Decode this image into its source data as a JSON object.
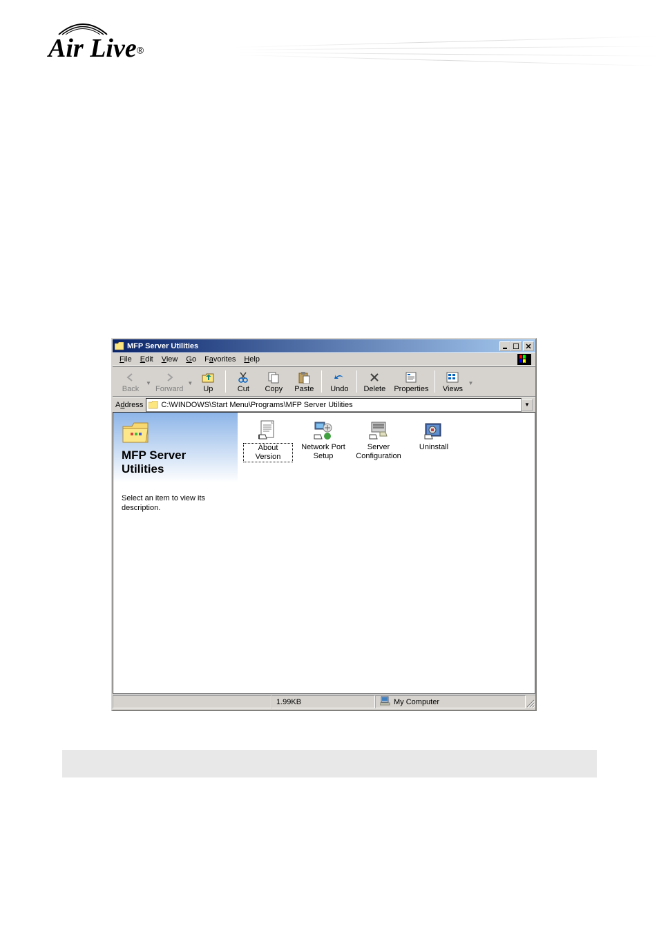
{
  "logo": {
    "brand": "Air Live",
    "registered": "®"
  },
  "window": {
    "title": "MFP Server Utilities"
  },
  "menubar": {
    "items": [
      {
        "label": "File",
        "accel": "F"
      },
      {
        "label": "Edit",
        "accel": "E"
      },
      {
        "label": "View",
        "accel": "V"
      },
      {
        "label": "Go",
        "accel": "G"
      },
      {
        "label": "Favorites",
        "accel": "a"
      },
      {
        "label": "Help",
        "accel": "H"
      }
    ]
  },
  "toolbar": {
    "back": "Back",
    "forward": "Forward",
    "up": "Up",
    "cut": "Cut",
    "copy": "Copy",
    "paste": "Paste",
    "undo": "Undo",
    "delete": "Delete",
    "properties": "Properties",
    "views": "Views"
  },
  "addressbar": {
    "label": "Address",
    "value": "C:\\WINDOWS\\Start Menu\\Programs\\MFP Server Utilities"
  },
  "sidebar": {
    "title": "MFP Server Utilities",
    "desc": "Select an item to view its description."
  },
  "files": {
    "items": [
      {
        "label": "About Version",
        "selected": true
      },
      {
        "label": "Network Port Setup",
        "selected": false
      },
      {
        "label": "Server Configuration",
        "selected": false
      },
      {
        "label": "Uninstall",
        "selected": false
      }
    ]
  },
  "statusbar": {
    "size": "1.99KB",
    "location": "My Computer"
  }
}
